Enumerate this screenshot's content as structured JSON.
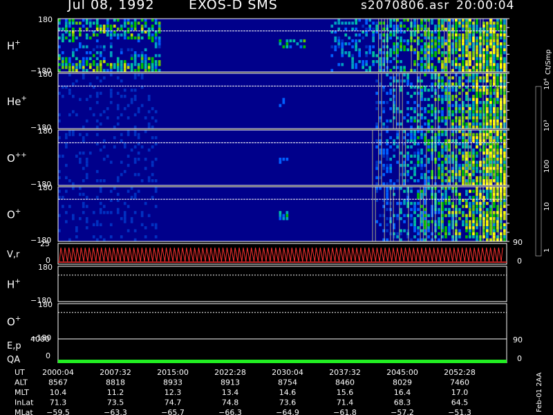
{
  "header": {
    "date": "Jul 08, 1992",
    "instrument": "EXOS-D SMS",
    "file": "s2070806.asr",
    "time": "20:00:04"
  },
  "chart_data": {
    "type": "heatmap",
    "panels": [
      {
        "id": "h-plus",
        "label": "H",
        "sup": "+",
        "ylim": [
          -180,
          180
        ],
        "ticks": [
          "180",
          "−180"
        ]
      },
      {
        "id": "he-plus",
        "label": "He",
        "sup": "+",
        "ylim": [
          -180,
          180
        ],
        "ticks": [
          "180",
          "−180"
        ]
      },
      {
        "id": "o-plusplus",
        "label": "O",
        "sup": "++",
        "ylim": [
          -180,
          180
        ],
        "ticks": [
          "180",
          "−180"
        ]
      },
      {
        "id": "o-plus",
        "label": "O",
        "sup": "+",
        "ylim": [
          -180,
          180
        ],
        "ticks": [
          "180",
          "−180"
        ]
      }
    ],
    "velocity_panel": {
      "label": "V,r",
      "left_ticks": [
        "25",
        "0"
      ],
      "right_ticks": [
        "90",
        "0"
      ]
    },
    "line_panels": [
      {
        "id": "h-plus-line",
        "label": "H",
        "sup": "+",
        "ticks": [
          "180",
          "−180"
        ]
      },
      {
        "id": "o-plus-line",
        "label": "O",
        "sup": "+",
        "ticks": [
          "180",
          "−180"
        ]
      }
    ],
    "ep_panel": {
      "label": "E,p",
      "left_ticks": [
        "4000"
      ],
      "right_ticks": [
        "90"
      ]
    },
    "qa_panel": {
      "label": "QA",
      "left_ticks": [
        "0"
      ],
      "right_ticks": [
        "0"
      ]
    },
    "colorbar": {
      "label": "Ct/Smp",
      "tick_labels": [
        "10⁴",
        "10³",
        "100",
        "10",
        "1"
      ],
      "colors": [
        "#ffffff",
        "#8b0000",
        "#b00000",
        "#ff0000",
        "#706000",
        "#a08800",
        "#ffff00",
        "#c8e000",
        "#64c800",
        "#00c000",
        "#00ffff",
        "#00aaaa",
        "#0060ff",
        "#0000a0"
      ]
    },
    "footer": {
      "rows": [
        {
          "label": "UT",
          "values": [
            "2000:04",
            "2007:32",
            "2015:00",
            "2022:28",
            "2030:04",
            "2037:32",
            "2045:00",
            "2052:28"
          ]
        },
        {
          "label": "ALT",
          "values": [
            "8567",
            "8818",
            "8933",
            "8913",
            "8754",
            "8460",
            "8029",
            "7460"
          ]
        },
        {
          "label": "MLT",
          "values": [
            "10.4",
            "11.2",
            "12.3",
            "13.4",
            "14.6",
            "15.6",
            "16.4",
            "17.0"
          ]
        },
        {
          "label": "InLat",
          "values": [
            "71.3",
            "73.5",
            "74.7",
            "74.8",
            "73.6",
            "71.4",
            "68.3",
            "64.5"
          ]
        },
        {
          "label": "MLat",
          "values": [
            "−59.5",
            "−63.3",
            "−65.7",
            "−66.3",
            "−64.9",
            "−61.8",
            "−57.2",
            "−51.3"
          ]
        }
      ]
    },
    "side_note": "Feb-01 2AA",
    "colors": {
      "background_field": "#00008b",
      "velocity_line": "#ff3030",
      "qa_bar": "#22ee22"
    }
  }
}
